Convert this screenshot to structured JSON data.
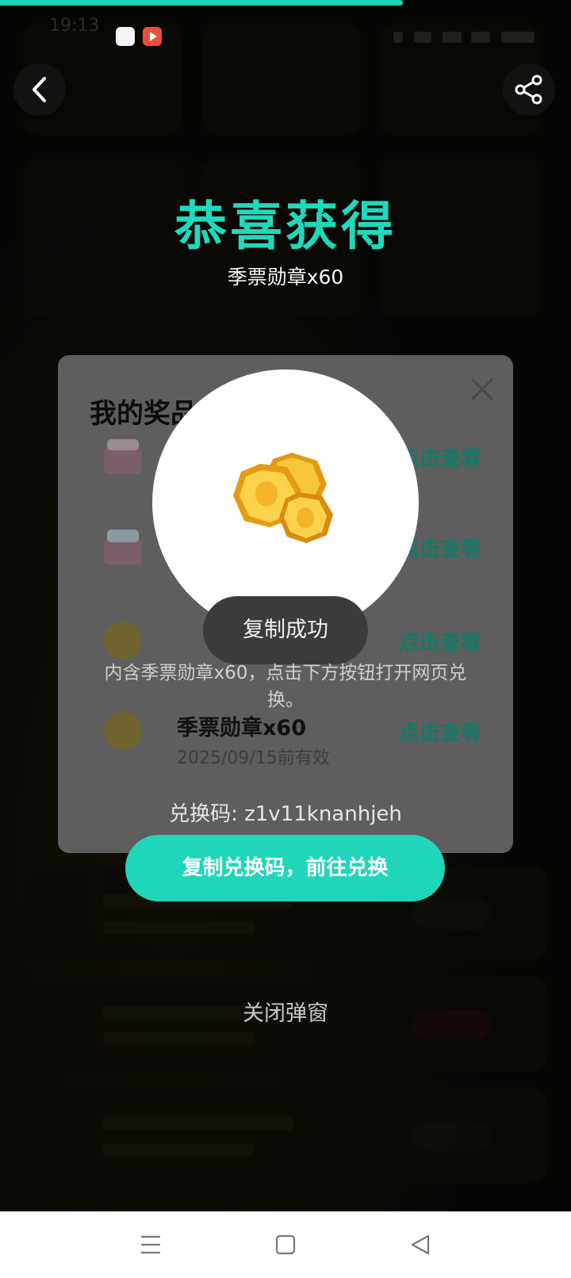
{
  "status_bar": {
    "time": "19:13"
  },
  "header": {
    "back_icon": "chevron-left-icon",
    "share_icon": "share-icon"
  },
  "congrats": {
    "title": "恭喜获得",
    "reward": "季票勋章x60"
  },
  "prize_list": {
    "title": "我的奖品",
    "link_label": "点击查看",
    "items": [
      {
        "name": "季票勋章x60",
        "date": "2025/09/15前有效",
        "icon": "coin-icon"
      }
    ]
  },
  "popup": {
    "toast": "复制成功",
    "description": "内含季票勋章x60，点击下方按钮打开网页兑换。",
    "code_label": "兑换码: ",
    "code": "z1v11knanhjeh",
    "cta": "复制兑换码，前往兑换",
    "close": "关闭弹窗"
  },
  "colors": {
    "accent": "#1fd9bd",
    "link": "#137a67"
  }
}
